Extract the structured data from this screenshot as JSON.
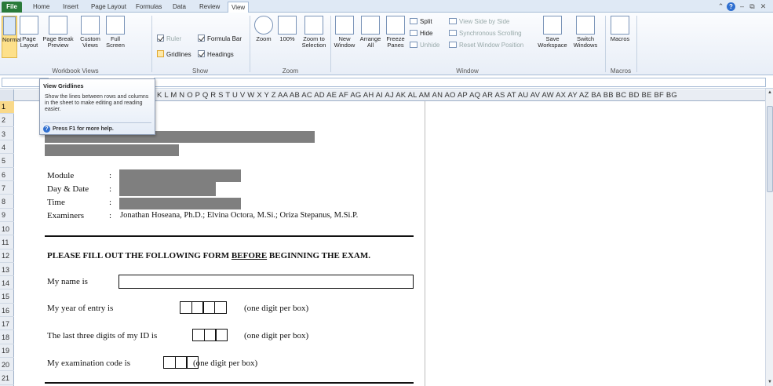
{
  "tabs": [
    "File",
    "Home",
    "Insert",
    "Page Layout",
    "Formulas",
    "Data",
    "Review",
    "View"
  ],
  "active_tab": "View",
  "ribbon": {
    "workbook_views": {
      "label": "Workbook Views",
      "normal": "Normal",
      "page_layout": "Page Layout",
      "page_break_preview": "Page Break Preview",
      "custom_views": "Custom Views",
      "full_screen": "Full Screen"
    },
    "show": {
      "label": "Show",
      "ruler": "Ruler",
      "formula_bar": "Formula Bar",
      "gridlines": "Gridlines",
      "headings": "Headings",
      "ruler_checked": true,
      "formula_bar_checked": true,
      "gridlines_checked": false,
      "headings_checked": true
    },
    "zoom": {
      "label": "Zoom",
      "zoom": "Zoom",
      "hundred": "100%",
      "zoom_to_selection": "Zoom to Selection"
    },
    "window": {
      "label": "Window",
      "new_window": "New Window",
      "arrange_all": "Arrange All",
      "freeze_panes": "Freeze Panes",
      "split": "Split",
      "hide": "Hide",
      "unhide": "Unhide",
      "view_side_by_side": "View Side by Side",
      "synchronous_scrolling": "Synchronous Scrolling",
      "reset_window_position": "Reset Window Position",
      "save_workspace": "Save Workspace",
      "switch_windows": "Switch Windows"
    },
    "macros": {
      "label": "Macros",
      "macros": "Macros"
    }
  },
  "tooltip": {
    "title": "View Gridlines",
    "body": "Show the lines between rows and columns in the sheet to make editing and reading easier.",
    "help": "Press F1 for more help."
  },
  "columns": "K L M N O P Q R S T U V W X Y Z AA AB AC AD AE AF AG AH AI AJ AK AL AM AN AO AP AQ AR AS AT AU AV AW AX AY AZ BA BB BC BD BE BF BG",
  "rows": [
    "1",
    "2",
    "3",
    "4",
    "5",
    "6",
    "7",
    "8",
    "9",
    "10",
    "11",
    "12",
    "13",
    "14",
    "15",
    "16",
    "17",
    "18",
    "19",
    "20",
    "21"
  ],
  "selected_row": "1",
  "document": {
    "module_label": "Module",
    "daydate_label": "Day & Date",
    "time_label": "Time",
    "examiners_label": "Examiners",
    "colon": ":",
    "examiners_value": "Jonathan Hoseana, Ph.D.; Elvina Octora, M.Si.; Oriza Stepanus, M.Si.P.",
    "instruction_pre": "PLEASE FILL OUT THE FOLLOWING FORM ",
    "instruction_underlined": "BEFORE",
    "instruction_post": " BEGINNING THE EXAM.",
    "name_label": "My name is",
    "year_label": "My year of entry is",
    "year_note": "(one digit per box)",
    "id_label": "The last three digits of my ID is",
    "id_note": "(one digit per box)",
    "code_label": "My examination code is",
    "code_note": "(one digit per box)"
  }
}
